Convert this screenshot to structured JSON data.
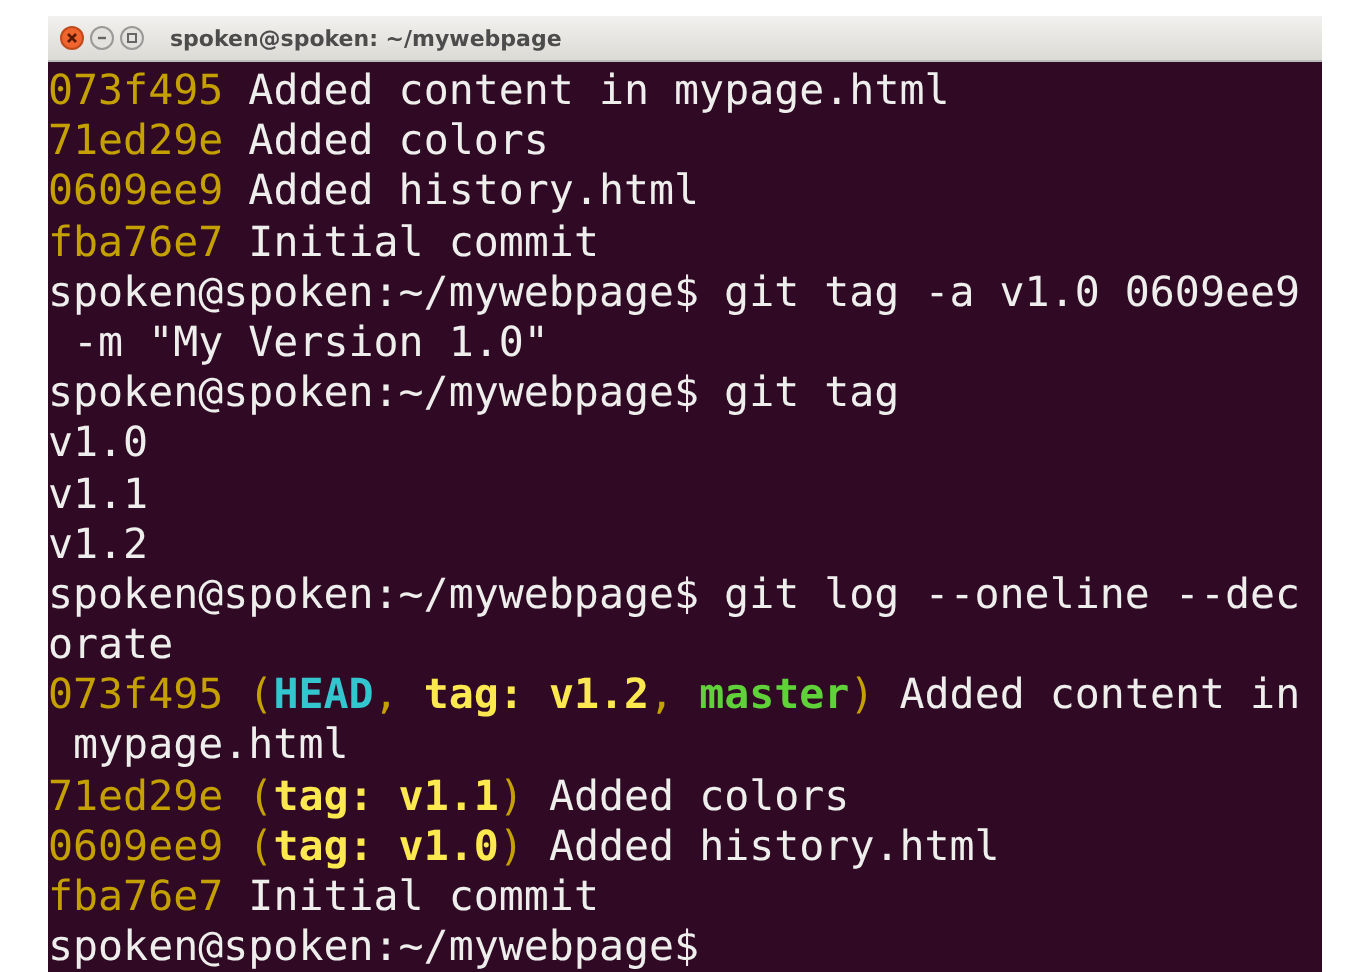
{
  "window": {
    "title": "spoken@spoken: ~/mywebpage"
  },
  "terminal": {
    "lines": [
      {
        "segments": [
          {
            "kind": "hash",
            "text": "073f495"
          },
          {
            "kind": "text",
            "text": " Added content in mypage.html"
          }
        ]
      },
      {
        "segments": [
          {
            "kind": "hash",
            "text": "71ed29e"
          },
          {
            "kind": "text",
            "text": " Added colors"
          }
        ]
      },
      {
        "segments": [
          {
            "kind": "hash",
            "text": "0609ee9"
          },
          {
            "kind": "text",
            "text": " Added history.html"
          }
        ]
      },
      {
        "segments": [
          {
            "kind": "hash",
            "text": "fba76e7"
          },
          {
            "kind": "text",
            "text": " Initial commit"
          }
        ]
      },
      {
        "segments": [
          {
            "kind": "text",
            "text": "spoken@spoken:~/mywebpage$ git tag -a v1.0 0609ee9"
          }
        ]
      },
      {
        "segments": [
          {
            "kind": "text",
            "text": " -m \"My Version 1.0\""
          }
        ]
      },
      {
        "segments": [
          {
            "kind": "text",
            "text": "spoken@spoken:~/mywebpage$ git tag"
          }
        ]
      },
      {
        "segments": [
          {
            "kind": "text",
            "text": "v1.0"
          }
        ]
      },
      {
        "segments": [
          {
            "kind": "text",
            "text": "v1.1"
          }
        ]
      },
      {
        "segments": [
          {
            "kind": "text",
            "text": "v1.2"
          }
        ]
      },
      {
        "segments": [
          {
            "kind": "text",
            "text": "spoken@spoken:~/mywebpage$ git log --oneline --dec"
          }
        ]
      },
      {
        "segments": [
          {
            "kind": "text",
            "text": "orate"
          }
        ]
      },
      {
        "segments": [
          {
            "kind": "hash",
            "text": "073f495"
          },
          {
            "kind": "paren",
            "text": " ("
          },
          {
            "kind": "head",
            "text": "HEAD"
          },
          {
            "kind": "paren",
            "text": ", "
          },
          {
            "kind": "tag",
            "text": "tag: v1.2"
          },
          {
            "kind": "paren",
            "text": ", "
          },
          {
            "kind": "branch",
            "text": "master"
          },
          {
            "kind": "paren",
            "text": ")"
          },
          {
            "kind": "text",
            "text": " Added content in"
          }
        ]
      },
      {
        "segments": [
          {
            "kind": "text",
            "text": " mypage.html"
          }
        ]
      },
      {
        "segments": [
          {
            "kind": "hash",
            "text": "71ed29e"
          },
          {
            "kind": "paren",
            "text": " ("
          },
          {
            "kind": "tag",
            "text": "tag: v1.1"
          },
          {
            "kind": "paren",
            "text": ")"
          },
          {
            "kind": "text",
            "text": " Added colors"
          }
        ]
      },
      {
        "segments": [
          {
            "kind": "hash",
            "text": "0609ee9"
          },
          {
            "kind": "paren",
            "text": " ("
          },
          {
            "kind": "tag",
            "text": "tag: v1.0"
          },
          {
            "kind": "paren",
            "text": ")"
          },
          {
            "kind": "text",
            "text": " Added history.html"
          }
        ]
      },
      {
        "segments": [
          {
            "kind": "hash",
            "text": "fba76e7"
          },
          {
            "kind": "text",
            "text": " Initial commit"
          }
        ]
      },
      {
        "segments": [
          {
            "kind": "text",
            "text": "spoken@spoken:~/mywebpage$"
          }
        ]
      }
    ]
  }
}
